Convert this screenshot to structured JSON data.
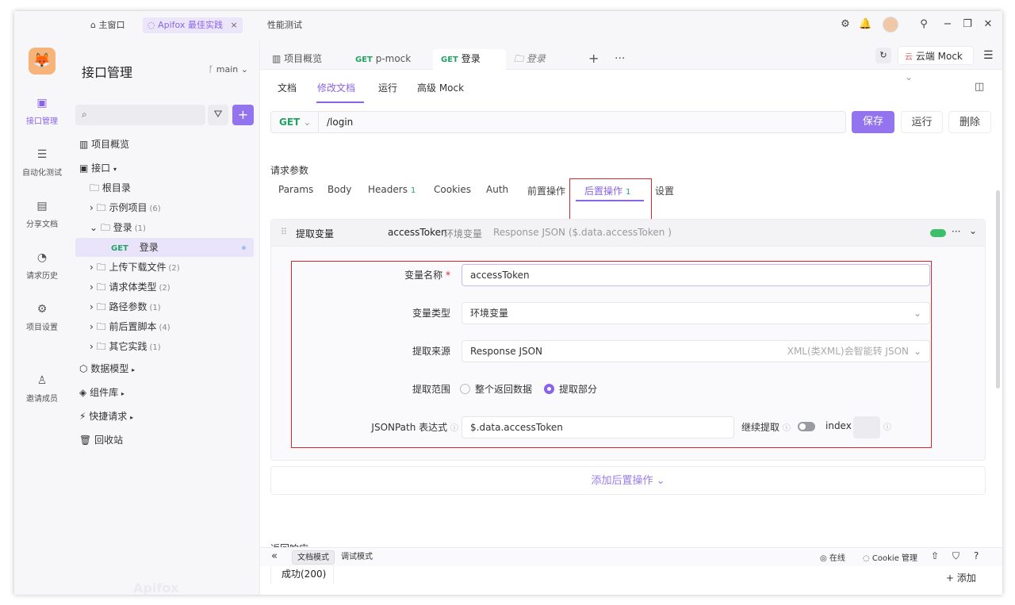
{
  "titlebar": {
    "tabs": [
      {
        "label": "主窗口"
      },
      {
        "label": "Apifox 最佳实践"
      },
      {
        "label": "性能测试"
      }
    ]
  },
  "rail": {
    "items": [
      {
        "label": "接口管理",
        "icon": "api-icon"
      },
      {
        "label": "自动化测试",
        "icon": "automation-icon"
      },
      {
        "label": "分享文档",
        "icon": "share-doc-icon"
      },
      {
        "label": "请求历史",
        "icon": "history-icon"
      },
      {
        "label": "项目设置",
        "icon": "settings-icon"
      },
      {
        "label": "邀请成员",
        "icon": "invite-icon"
      }
    ]
  },
  "sidebar": {
    "title": "接口管理",
    "branch": "main",
    "tree": [
      {
        "label": "项目概览"
      },
      {
        "label": "接口"
      },
      {
        "label": "根目录"
      },
      {
        "label": "示例项目",
        "count": "(6)"
      },
      {
        "label": "登录",
        "count": "(1)"
      },
      {
        "label": "登录",
        "method": "GET"
      },
      {
        "label": "上传下载文件",
        "count": "(2)"
      },
      {
        "label": "请求体类型",
        "count": "(2)"
      },
      {
        "label": "路径参数",
        "count": "(1)"
      },
      {
        "label": "前后置脚本",
        "count": "(4)"
      },
      {
        "label": "其它实践",
        "count": "(1)"
      },
      {
        "label": "数据模型"
      },
      {
        "label": "组件库"
      },
      {
        "label": "快捷请求"
      },
      {
        "label": "回收站"
      }
    ],
    "watermark": "Apifox"
  },
  "doc_tabs": [
    {
      "label": "项目概览"
    },
    {
      "method": "GET",
      "label": "p-mock"
    },
    {
      "method": "GET",
      "label": "登录"
    },
    {
      "label": "登录"
    }
  ],
  "env": {
    "prefix": "云",
    "label": "云端 Mock"
  },
  "subtabs": [
    "文档",
    "修改文档",
    "运行",
    "高级 Mock"
  ],
  "request": {
    "method": "GET",
    "path": "/login",
    "save": "保存",
    "run": "运行",
    "delete": "删除"
  },
  "params": {
    "section_label": "请求参数",
    "tabs": [
      {
        "label": "Params"
      },
      {
        "label": "Body"
      },
      {
        "label": "Headers",
        "badge": "1"
      },
      {
        "label": "Cookies"
      },
      {
        "label": "Auth"
      },
      {
        "label": "前置操作"
      },
      {
        "label": "后置操作",
        "badge": "1"
      },
      {
        "label": "设置"
      }
    ]
  },
  "extract": {
    "header_title": "提取变量",
    "header_var": "accessToken",
    "header_type": "环境变量",
    "header_source": "Response JSON ($.data.accessToken )",
    "labels": {
      "var_name": "变量名称",
      "var_type": "变量类型",
      "source": "提取来源",
      "scope": "提取范围",
      "jsonpath": "JSONPath 表达式",
      "continue": "继续提取",
      "index": "index"
    },
    "required_mark": "*",
    "var_name": "accessToken",
    "var_type": "环境变量",
    "source": "Response JSON",
    "source_hint": "XML(类XML)会智能转 JSON",
    "scope_options": [
      "整个返回数据",
      "提取部分"
    ],
    "scope_selected": 1,
    "jsonpath": "$.data.accessToken"
  },
  "add_post_op": "添加后置操作",
  "response": {
    "section_label": "返回响应",
    "tab": "成功(200)",
    "add": "+ 添加"
  },
  "bottombar": {
    "modes": [
      "文档模式",
      "调试模式"
    ],
    "status": "在线",
    "cookie": "Cookie 管理"
  },
  "colors": {
    "accent": "#8a63e8",
    "get": "#21a366",
    "highlight": "#d9262c"
  }
}
